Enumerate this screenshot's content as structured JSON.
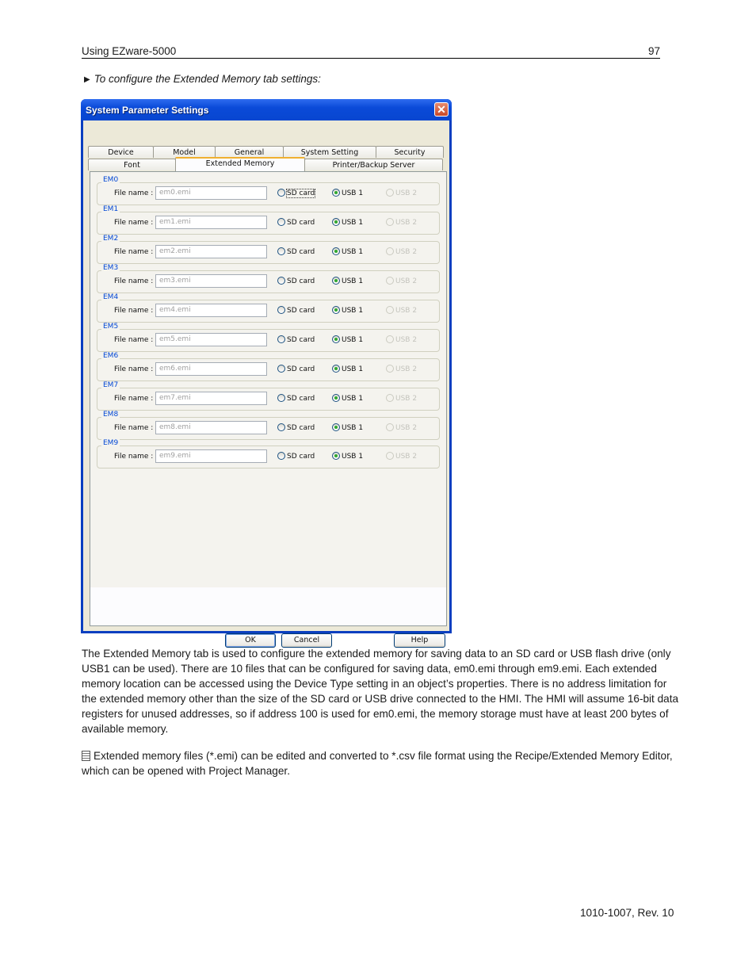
{
  "header": {
    "left": "Using EZware-5000",
    "page_number": "97"
  },
  "step": {
    "icon": "triangle-right-icon",
    "text": "To configure the Extended Memory tab settings:"
  },
  "dialog": {
    "title": "System Parameter Settings",
    "close_icon": "close-icon",
    "tabs_row1": [
      "Device",
      "Model",
      "General",
      "System Setting",
      "Security"
    ],
    "tabs_row2": [
      "Font",
      "Extended Memory",
      "Printer/Backup Server"
    ],
    "active_tab": "Extended Memory",
    "file_label": "File name :",
    "radio_labels": {
      "sd": "SD card",
      "usb1": "USB 1",
      "usb2": "USB 2"
    },
    "groups": [
      {
        "name": "EM0",
        "file": "em0.emi",
        "selected": "USB 1"
      },
      {
        "name": "EM1",
        "file": "em1.emi",
        "selected": "USB 1"
      },
      {
        "name": "EM2",
        "file": "em2.emi",
        "selected": "USB 1"
      },
      {
        "name": "EM3",
        "file": "em3.emi",
        "selected": "USB 1"
      },
      {
        "name": "EM4",
        "file": "em4.emi",
        "selected": "USB 1"
      },
      {
        "name": "EM5",
        "file": "em5.emi",
        "selected": "USB 1"
      },
      {
        "name": "EM6",
        "file": "em6.emi",
        "selected": "USB 1"
      },
      {
        "name": "EM7",
        "file": "em7.emi",
        "selected": "USB 1"
      },
      {
        "name": "EM8",
        "file": "em8.emi",
        "selected": "USB 1"
      },
      {
        "name": "EM9",
        "file": "em9.emi",
        "selected": "USB 1"
      }
    ],
    "buttons": {
      "ok": "OK",
      "cancel": "Cancel",
      "help": "Help"
    }
  },
  "body": {
    "paragraph": "The Extended Memory tab is used to configure the extended memory for saving data to an SD card or USB flash drive (only USB1  can be used). There are 10 files that can be configured for saving data, em0.emi through em9.emi. Each extended memory location can be accessed using the Device Type setting in an object’s properties. There is no address limitation for the extended memory other than the size of the SD card or USB drive connected to the HMI. The HMI will assume 16-bit data registers for unused addresses, so if address 100 is used for em0.emi, the memory storage must have at least 200 bytes of available memory.",
    "note_icon": "note-icon",
    "note": "Extended memory files (*.emi) can be edited and converted to *.csv file format using the Recipe/Extended Memory Editor, which can be opened with Project Manager."
  },
  "footer": {
    "doc_number": "1010-1007, Rev. 10"
  }
}
